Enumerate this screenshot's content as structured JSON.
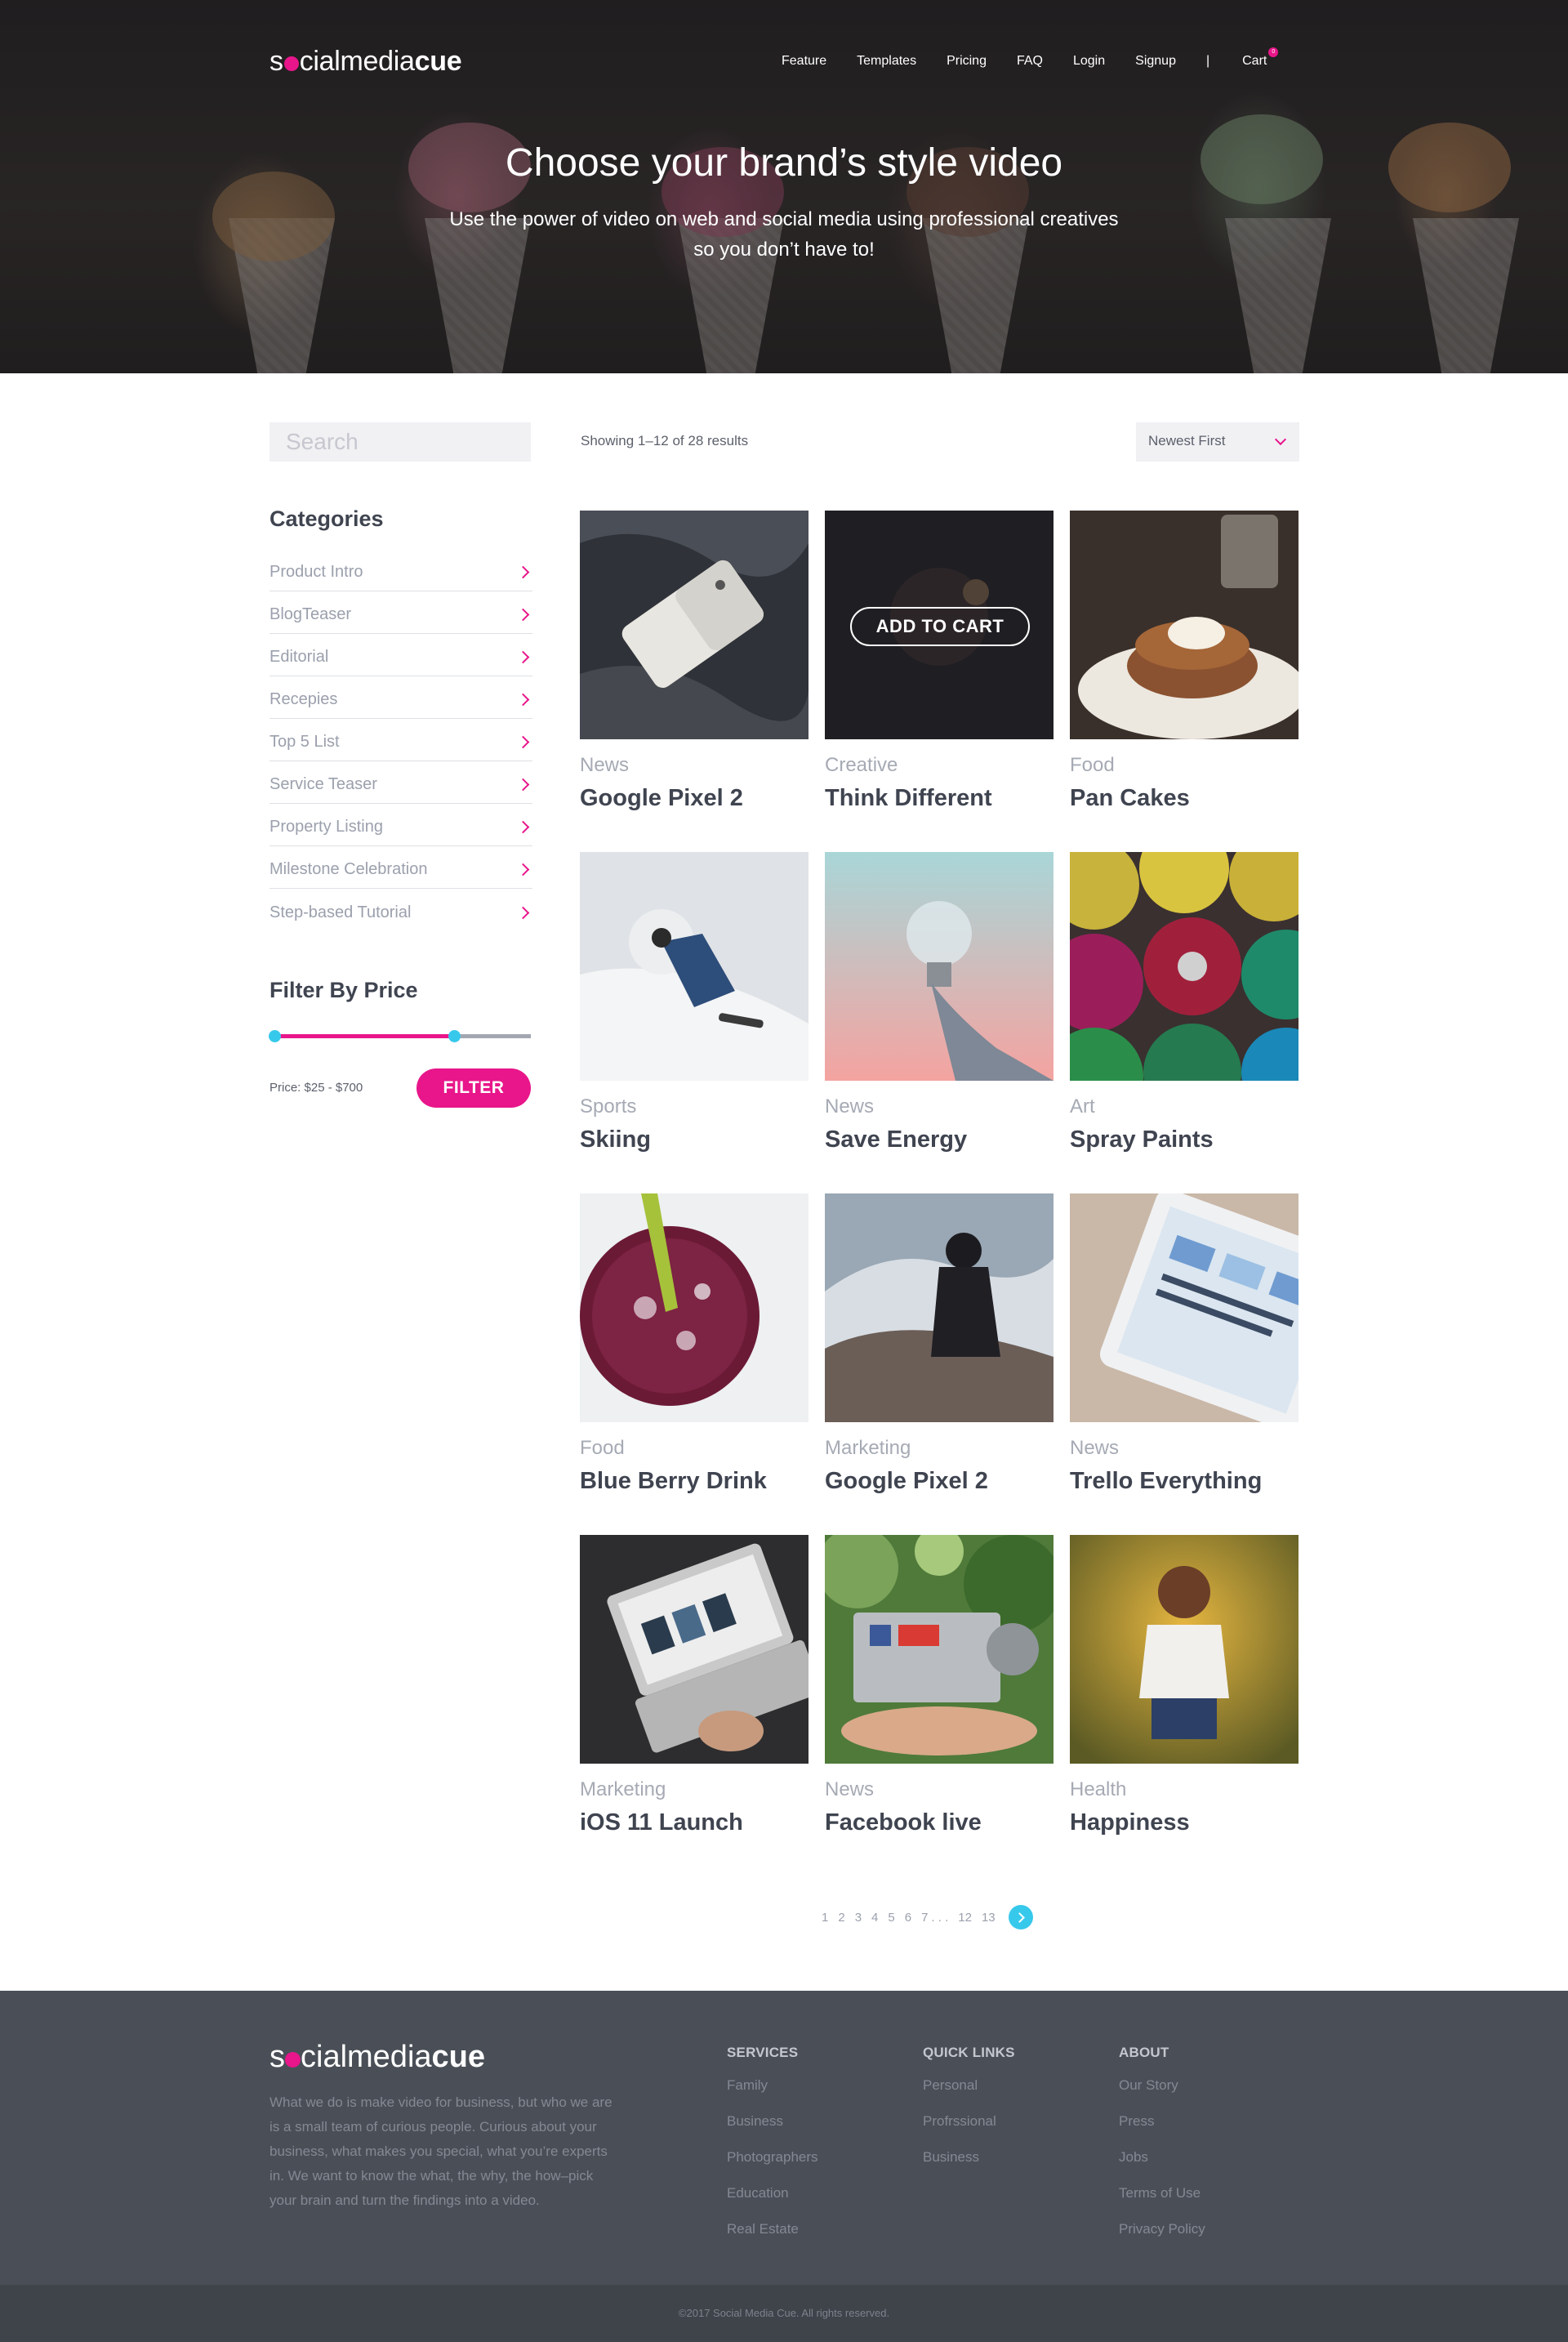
{
  "brand": {
    "logo_s": "s",
    "logo_rest": "cialmedia",
    "logo_bold": "cue"
  },
  "nav": {
    "items": [
      "Feature",
      "Templates",
      "Pricing",
      "FAQ",
      "Login",
      "Signup"
    ],
    "separator": "|",
    "cart": "Cart",
    "cart_count": "0"
  },
  "hero": {
    "title": "Choose your brand’s style video",
    "subtitle_line1": "Use the power of video on web and social media using professional creatives",
    "subtitle_line2": "so you don’t have to!"
  },
  "sidebar": {
    "search_placeholder": "Search",
    "categories_title": "Categories",
    "categories": [
      "Product Intro",
      "BlogTeaser",
      "Editorial",
      "Recepies",
      "Top 5 List",
      "Service Teaser",
      "Property Listing",
      "Milestone Celebration",
      "Step-based Tutorial"
    ],
    "filter_title": "Filter By Price",
    "price_min_fraction": 0.0,
    "price_max_fraction": 0.7,
    "price_label": "Price: $25 - $700",
    "filter_button": "FILTER"
  },
  "results": {
    "showing": "Showing 1–12 of 28 results",
    "sort": "Newest First",
    "add_to_cart": "ADD TO CART",
    "products": [
      {
        "category": "News",
        "title": "Google Pixel 2"
      },
      {
        "category": "Creative",
        "title": "Think Different"
      },
      {
        "category": "Food",
        "title": "Pan Cakes"
      },
      {
        "category": "Sports",
        "title": "Skiing"
      },
      {
        "category": "News",
        "title": "Save Energy"
      },
      {
        "category": "Art",
        "title": "Spray Paints"
      },
      {
        "category": "Food",
        "title": "Blue Berry Drink"
      },
      {
        "category": "Marketing",
        "title": "Google Pixel 2"
      },
      {
        "category": "News",
        "title": "Trello Everything"
      },
      {
        "category": "Marketing",
        "title": "iOS 11 Launch"
      },
      {
        "category": "News",
        "title": "Facebook live"
      },
      {
        "category": "Health",
        "title": "Happiness"
      }
    ],
    "pagination": [
      "1",
      "2",
      "3",
      "4",
      "5",
      "6",
      "7",
      ". . .",
      "12",
      "13"
    ]
  },
  "footer": {
    "description": "What we do is make video for business, but who we are is a small team of curious people. Curious about your business, what makes you special, what you’re experts in. We want to know the what, the why, the how–pick your brain and turn the findings into a video.",
    "services_title": "SERVICES",
    "services": [
      "Family",
      "Business",
      "Photographers",
      "Education",
      "Real Estate"
    ],
    "quick_title": "QUICK LINKS",
    "quick": [
      "Personal",
      "Profrssional",
      "Business"
    ],
    "about_title": "ABOUT",
    "about": [
      "Our Story",
      "Press",
      "Jobs",
      "Terms of Use",
      "Privacy Policy"
    ],
    "copyright": "©2017 Social Media Cue. All rights reserved."
  },
  "colors": {
    "accent": "#e8168a",
    "cyan": "#37c9ec",
    "footer_bg": "#4a4f57",
    "copyright_bg": "#3f434a"
  }
}
